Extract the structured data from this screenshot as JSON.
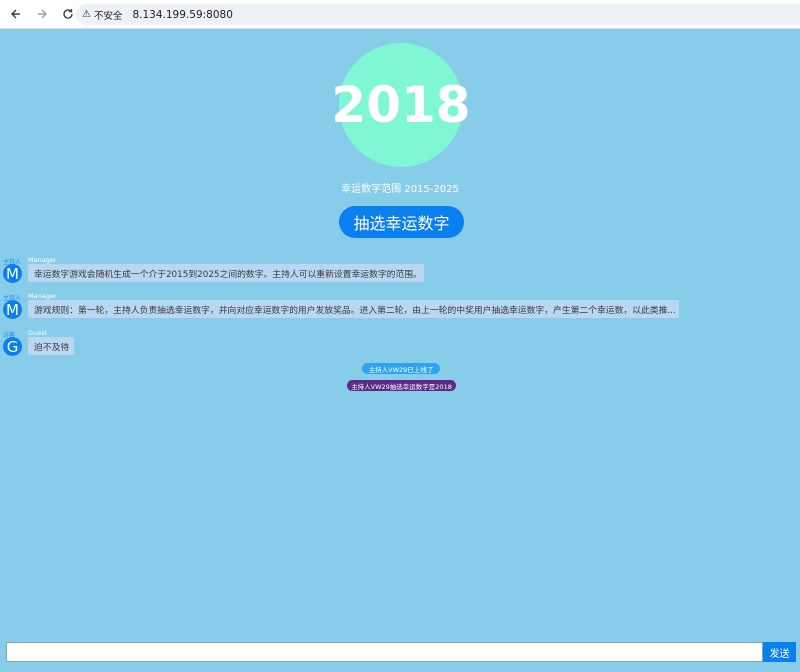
{
  "browser": {
    "insecure_label": "不安全",
    "url": "8.134.199.59:8080"
  },
  "lucky": {
    "number": "2018",
    "range_text": "幸运数字范围 2015-2025",
    "draw_button": "抽选幸运数字"
  },
  "messages": [
    {
      "role": "主持人",
      "avatar": "M",
      "name": "Manager",
      "text": "幸运数字游戏会随机生成一个介于2015到2025之间的数字。主持人可以重新设置幸运数字的范围。"
    },
    {
      "role": "主持人",
      "avatar": "M",
      "name": "Manager",
      "text": "游戏规则：第一轮，主持人负责抽选幸运数字，并向对应幸运数字的用户发放奖品。进入第二轮，由上一轮的中奖用户抽选幸运数字，产生第二个幸运数，以此类推..."
    },
    {
      "role": "访客",
      "avatar": "G",
      "name": "Guest",
      "text": "迫不及待"
    }
  ],
  "notices": {
    "online": "主持人VW29已上线了",
    "result": "主持人VW29抽选幸运数字是2018"
  },
  "input": {
    "value": "",
    "placeholder": "",
    "send_label": "发送"
  },
  "colors": {
    "background": "#87cdea",
    "accent": "#0a7ff0",
    "circle": "#7ff7d5",
    "bubble": "#b9d7f3",
    "notice_purple": "#5b2a86"
  }
}
